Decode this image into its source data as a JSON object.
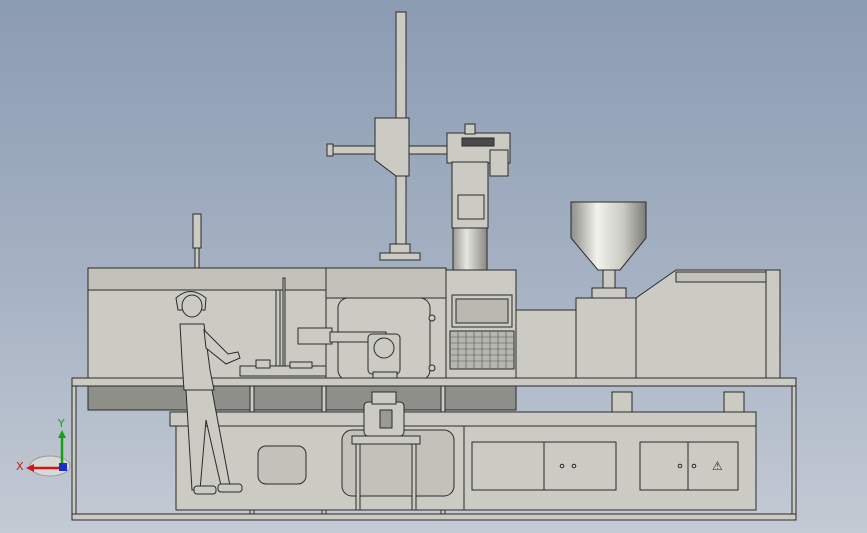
{
  "viewport": {
    "background_top": "#8b9bb2",
    "background_bottom": "#c4cad4",
    "model_fill": "#cbcbc3",
    "model_stroke": "#2a2a2a"
  },
  "triad": {
    "x_label": "X",
    "y_label": "Y",
    "x_color": "#d01818",
    "y_color": "#18a018",
    "z_color": "#1830c8"
  },
  "panel_labels": {
    "warning_symbol": "⚠"
  }
}
